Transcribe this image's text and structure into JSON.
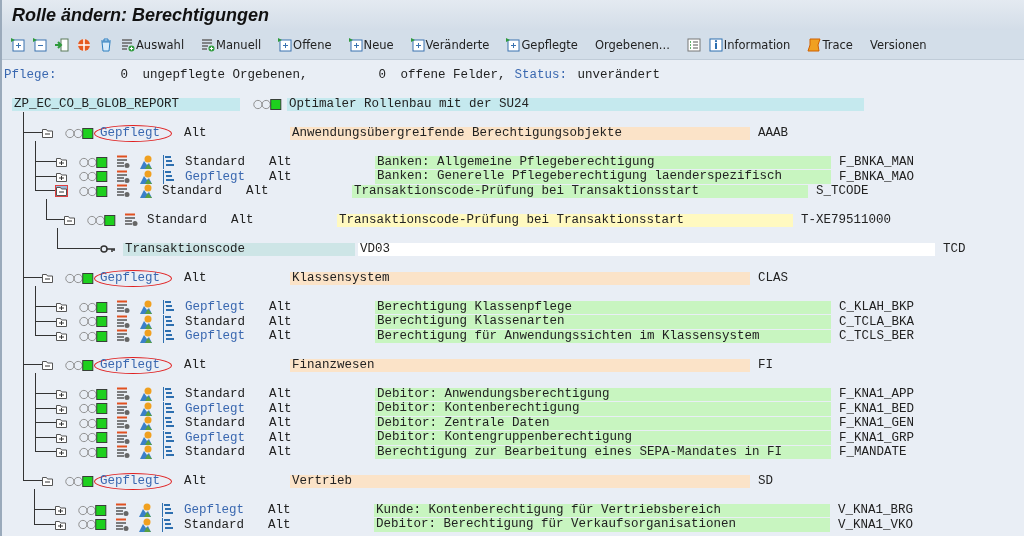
{
  "window": {
    "title": "Rolle ändern: Berechtigungen"
  },
  "toolbar": [
    {
      "kind": "expand"
    },
    {
      "kind": "collapse"
    },
    {
      "kind": "move"
    },
    {
      "kind": "palette"
    },
    {
      "kind": "delete"
    },
    {
      "kind": "select",
      "label": "Auswahl"
    },
    {
      "kind": "select",
      "label": "Manuell"
    },
    {
      "kind": "node",
      "label": "Offene"
    },
    {
      "kind": "node",
      "label": "Neue"
    },
    {
      "kind": "node",
      "label": "Veränderte"
    },
    {
      "kind": "node",
      "label": "Gepflegte"
    },
    {
      "kind": "text",
      "label": "Orgebenen..."
    },
    {
      "kind": "list"
    },
    {
      "kind": "info",
      "label": "Information"
    },
    {
      "kind": "scroll",
      "label": "Trace"
    },
    {
      "kind": "text",
      "label": "Versionen"
    }
  ],
  "summary": {
    "label": "Pflege:",
    "open_orgs": "0",
    "open_orgs_text": "ungepflegte Orgebenen,",
    "open_fields": "0",
    "open_fields_text": "offene Felder,",
    "status_label": "Status:",
    "status": "unverändert"
  },
  "role": {
    "name": "ZP_EC_CO_B_GLOB_REPORT",
    "text": "Optimaler Rollenbau mit der SU24",
    "children": [
      {
        "status": "Gepflegt",
        "maintained": true,
        "circled": true,
        "expanded": true,
        "version": "Alt",
        "text": "Anwendungsübergreifende Berechtigungsobjekte",
        "code": "AAAB",
        "children": [
          {
            "status": "Standard",
            "maintained": false,
            "expanded": false,
            "selected": false,
            "version": "Alt",
            "text": "Banken: Allgemeine Pflegeberechtigung",
            "code": "F_BNKA_MAN"
          },
          {
            "status": "Gepflegt",
            "maintained": true,
            "expanded": false,
            "selected": false,
            "version": "Alt",
            "text": "Banken: Generelle Pflegeberechtigung laenderspezifisch",
            "code": "F_BNKA_MAO"
          },
          {
            "status": "Standard",
            "maintained": false,
            "expanded": true,
            "selected": true,
            "version": "Alt",
            "text": "Transaktionscode-Prüfung bei Transaktionsstart",
            "code": "S_TCODE",
            "children": [
              {
                "status": "Standard",
                "maintained": false,
                "expanded": true,
                "version": "Alt",
                "text": "Transaktionscode-Prüfung bei Transaktionsstart",
                "code": "T-XE79511000",
                "children": [
                  {
                    "name": "Transaktionscode",
                    "value": "VD03",
                    "code": "TCD"
                  }
                ]
              }
            ]
          }
        ]
      },
      {
        "status": "Gepflegt",
        "maintained": true,
        "circled": true,
        "expanded": true,
        "version": "Alt",
        "text": "Klassensystem",
        "code": "CLAS",
        "children": [
          {
            "status": "Gepflegt",
            "maintained": true,
            "expanded": false,
            "selected": false,
            "version": "Alt",
            "text": "Berechtigung Klassenpflege",
            "code": "C_KLAH_BKP"
          },
          {
            "status": "Standard",
            "maintained": false,
            "expanded": false,
            "selected": false,
            "version": "Alt",
            "text": "Berechtigung Klassenarten",
            "code": "C_TCLA_BKA"
          },
          {
            "status": "Gepflegt",
            "maintained": true,
            "expanded": false,
            "selected": false,
            "version": "Alt",
            "text": "Berechtigung für Anwendungssichten im Klassensystem",
            "code": "C_TCLS_BER"
          }
        ]
      },
      {
        "status": "Gepflegt",
        "maintained": true,
        "circled": true,
        "expanded": true,
        "version": "Alt",
        "text": "Finanzwesen",
        "code": "FI",
        "children": [
          {
            "status": "Standard",
            "maintained": false,
            "expanded": false,
            "selected": false,
            "version": "Alt",
            "text": "Debitor: Anwendungsberechtigung",
            "code": "F_KNA1_APP"
          },
          {
            "status": "Gepflegt",
            "maintained": true,
            "expanded": false,
            "selected": false,
            "version": "Alt",
            "text": "Debitor: Kontenberechtigung",
            "code": "F_KNA1_BED"
          },
          {
            "status": "Standard",
            "maintained": false,
            "expanded": false,
            "selected": false,
            "version": "Alt",
            "text": "Debitor: Zentrale Daten",
            "code": "F_KNA1_GEN"
          },
          {
            "status": "Gepflegt",
            "maintained": true,
            "expanded": false,
            "selected": false,
            "version": "Alt",
            "text": "Debitor: Kontengruppenberechtigung",
            "code": "F_KNA1_GRP"
          },
          {
            "status": "Standard",
            "maintained": false,
            "expanded": false,
            "selected": false,
            "version": "Alt",
            "text": "Berechtigung zur Bearbeitung eines SEPA-Mandates in FI",
            "code": "F_MANDATE"
          }
        ]
      },
      {
        "status": "Gepflegt",
        "maintained": true,
        "circled": true,
        "expanded": true,
        "version": "Alt",
        "text": "Vertrieb",
        "code": "SD",
        "children": [
          {
            "status": "Gepflegt",
            "maintained": true,
            "expanded": false,
            "selected": false,
            "version": "Alt",
            "text": "Kunde: Kontenberechtigung für Vertriebsbereich",
            "code": "V_KNA1_BRG"
          },
          {
            "status": "Standard",
            "maintained": false,
            "expanded": false,
            "selected": false,
            "version": "Alt",
            "text": "Debitor: Berechtigung für Verkaufsorganisationen",
            "code": "V_KNA1_VKO"
          }
        ]
      }
    ]
  }
}
